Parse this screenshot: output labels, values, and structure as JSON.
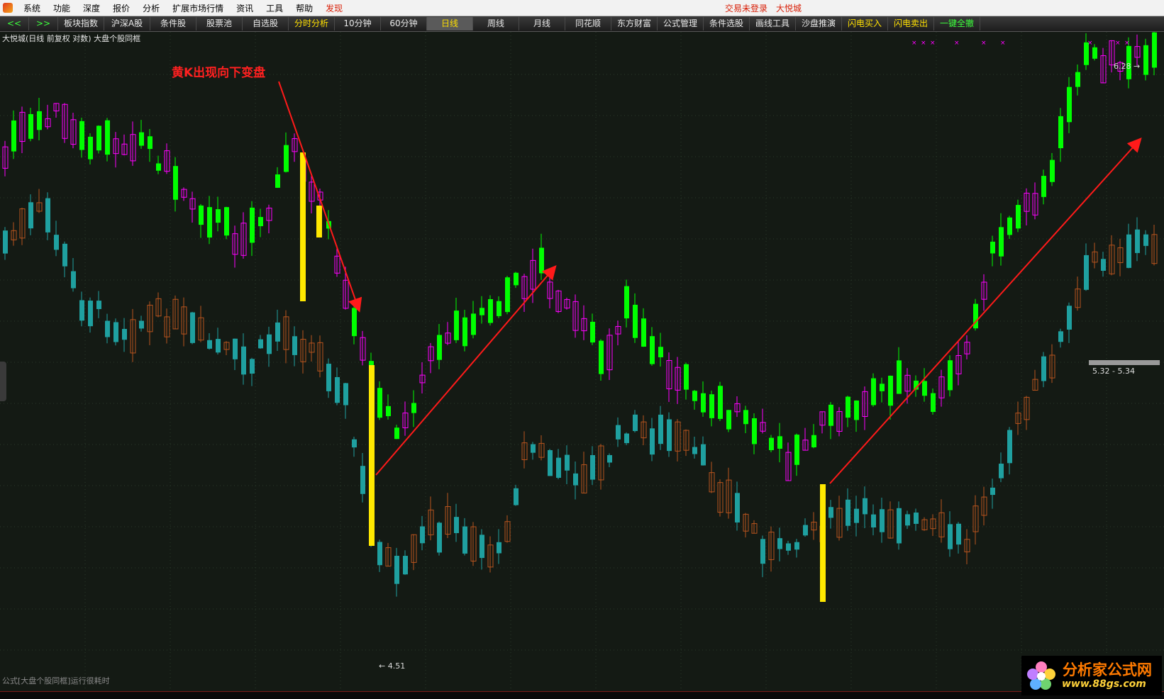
{
  "menubar": {
    "items": [
      "系统",
      "功能",
      "深度",
      "报价",
      "分析",
      "扩展市场行情",
      "资讯",
      "工具",
      "帮助"
    ],
    "discover": "发现",
    "login_status": "交易未登录",
    "user": "大悦城"
  },
  "toolbar": {
    "nav_left": "<<",
    "nav_right": ">>",
    "buttons": [
      "板块指数",
      "沪深A股",
      "条件股",
      "股票池",
      "自选股",
      "分时分析",
      "10分钟",
      "60分钟",
      "日线",
      "周线",
      "月线",
      "同花顺",
      "东方财富",
      "公式管理",
      "条件选股",
      "画线工具",
      "沙盘推演",
      "闪电买入",
      "闪电卖出",
      "一键全撤"
    ]
  },
  "chart": {
    "title": "大悦城(日线 前复权 对数) 大盘个股同框",
    "annotation": "黄K出现向下变盘",
    "low_label": "4.51",
    "high_label": "6.28",
    "range_label": "5.32 - 5.34",
    "status": "公式[大盘个股同框]运行很耗时"
  },
  "colors": {
    "up_yang": "#ff00ff",
    "down_yin": "#00ff00",
    "teal": "#1fa0a0",
    "brown": "#b8541e",
    "yellow": "#ffe800",
    "arrow": "#ff1a1a"
  },
  "watermark": {
    "line1": "分析家公式网",
    "line2": "www.88gs.com"
  }
}
